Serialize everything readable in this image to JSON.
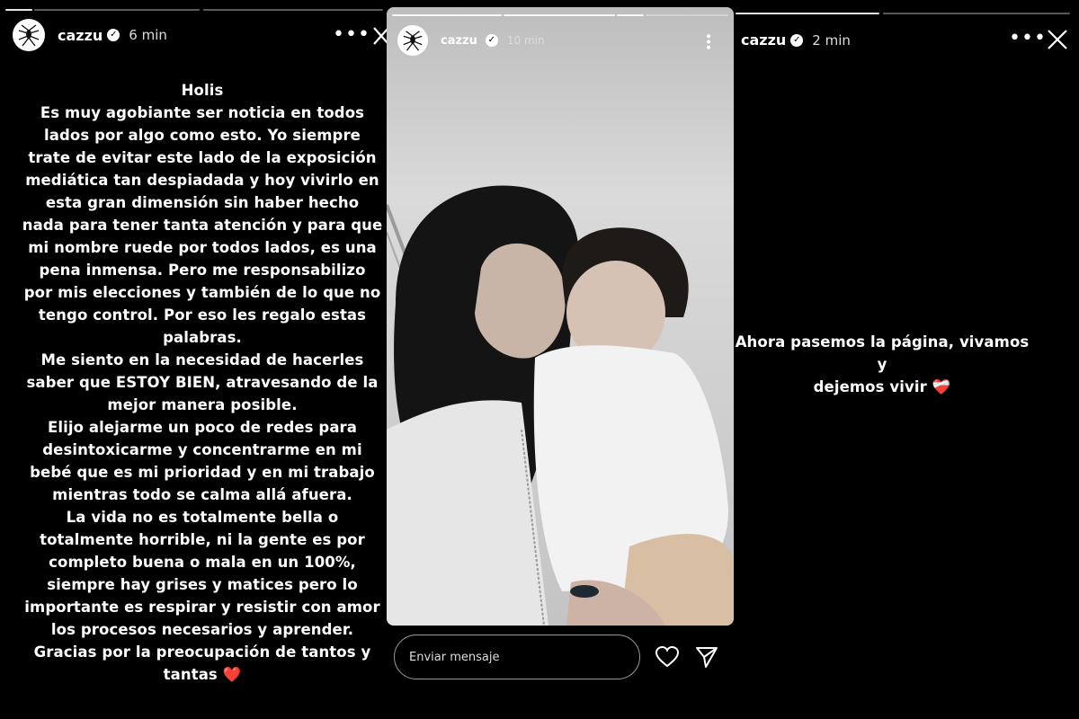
{
  "stories": [
    {
      "username": "cazzu",
      "time": "6 min",
      "text": [
        "Holis",
        "Es muy agobiante ser noticia en todos",
        "lados por algo como esto. Yo siempre",
        "trate de evitar este lado de la exposición",
        "mediática tan despiadada y hoy vivirlo en",
        "esta gran dimensión sin haber hecho",
        "nada para tener tanta atención y para que",
        "mi nombre ruede por todos lados, es una",
        "pena inmensa. Pero me responsabilizo",
        "por mis elecciones y también de lo que no",
        "tengo control. Por eso les regalo estas",
        "palabras.",
        "Me siento en la necesidad de hacerles",
        "saber que ESTOY BIEN, atravesando de la",
        "mejor manera posible.",
        "Elijo alejarme un poco de redes para",
        "desintoxicarme y concentrarme en mi",
        "bebé que es mi prioridad y en mi trabajo",
        "mientras todo se calma allá afuera.",
        "La vida no es totalmente bella o",
        "totalmente horrible, ni la gente es por",
        "completo buena o mala en un 100%,",
        "siempre hay grises y matices pero lo",
        "importante es respirar y resistir con amor",
        "los procesos necesarios y aprender.",
        "Gracias por la preocupación de tantos y",
        "tantas ❤️"
      ]
    },
    {
      "username": "cazzu",
      "time": "10 min",
      "reply_placeholder": "Enviar mensaje"
    },
    {
      "username": "cazzu",
      "time": "2 min",
      "text": [
        "Ahora pasemos la página, vivamos y",
        "dejemos vivir ❤️‍🩹"
      ]
    }
  ],
  "icons": {
    "more": "more-options-icon",
    "close": "close-icon",
    "verified": "verified-badge-icon",
    "like": "heart-icon",
    "share": "send-icon",
    "avatar": "spider-logo-icon"
  }
}
